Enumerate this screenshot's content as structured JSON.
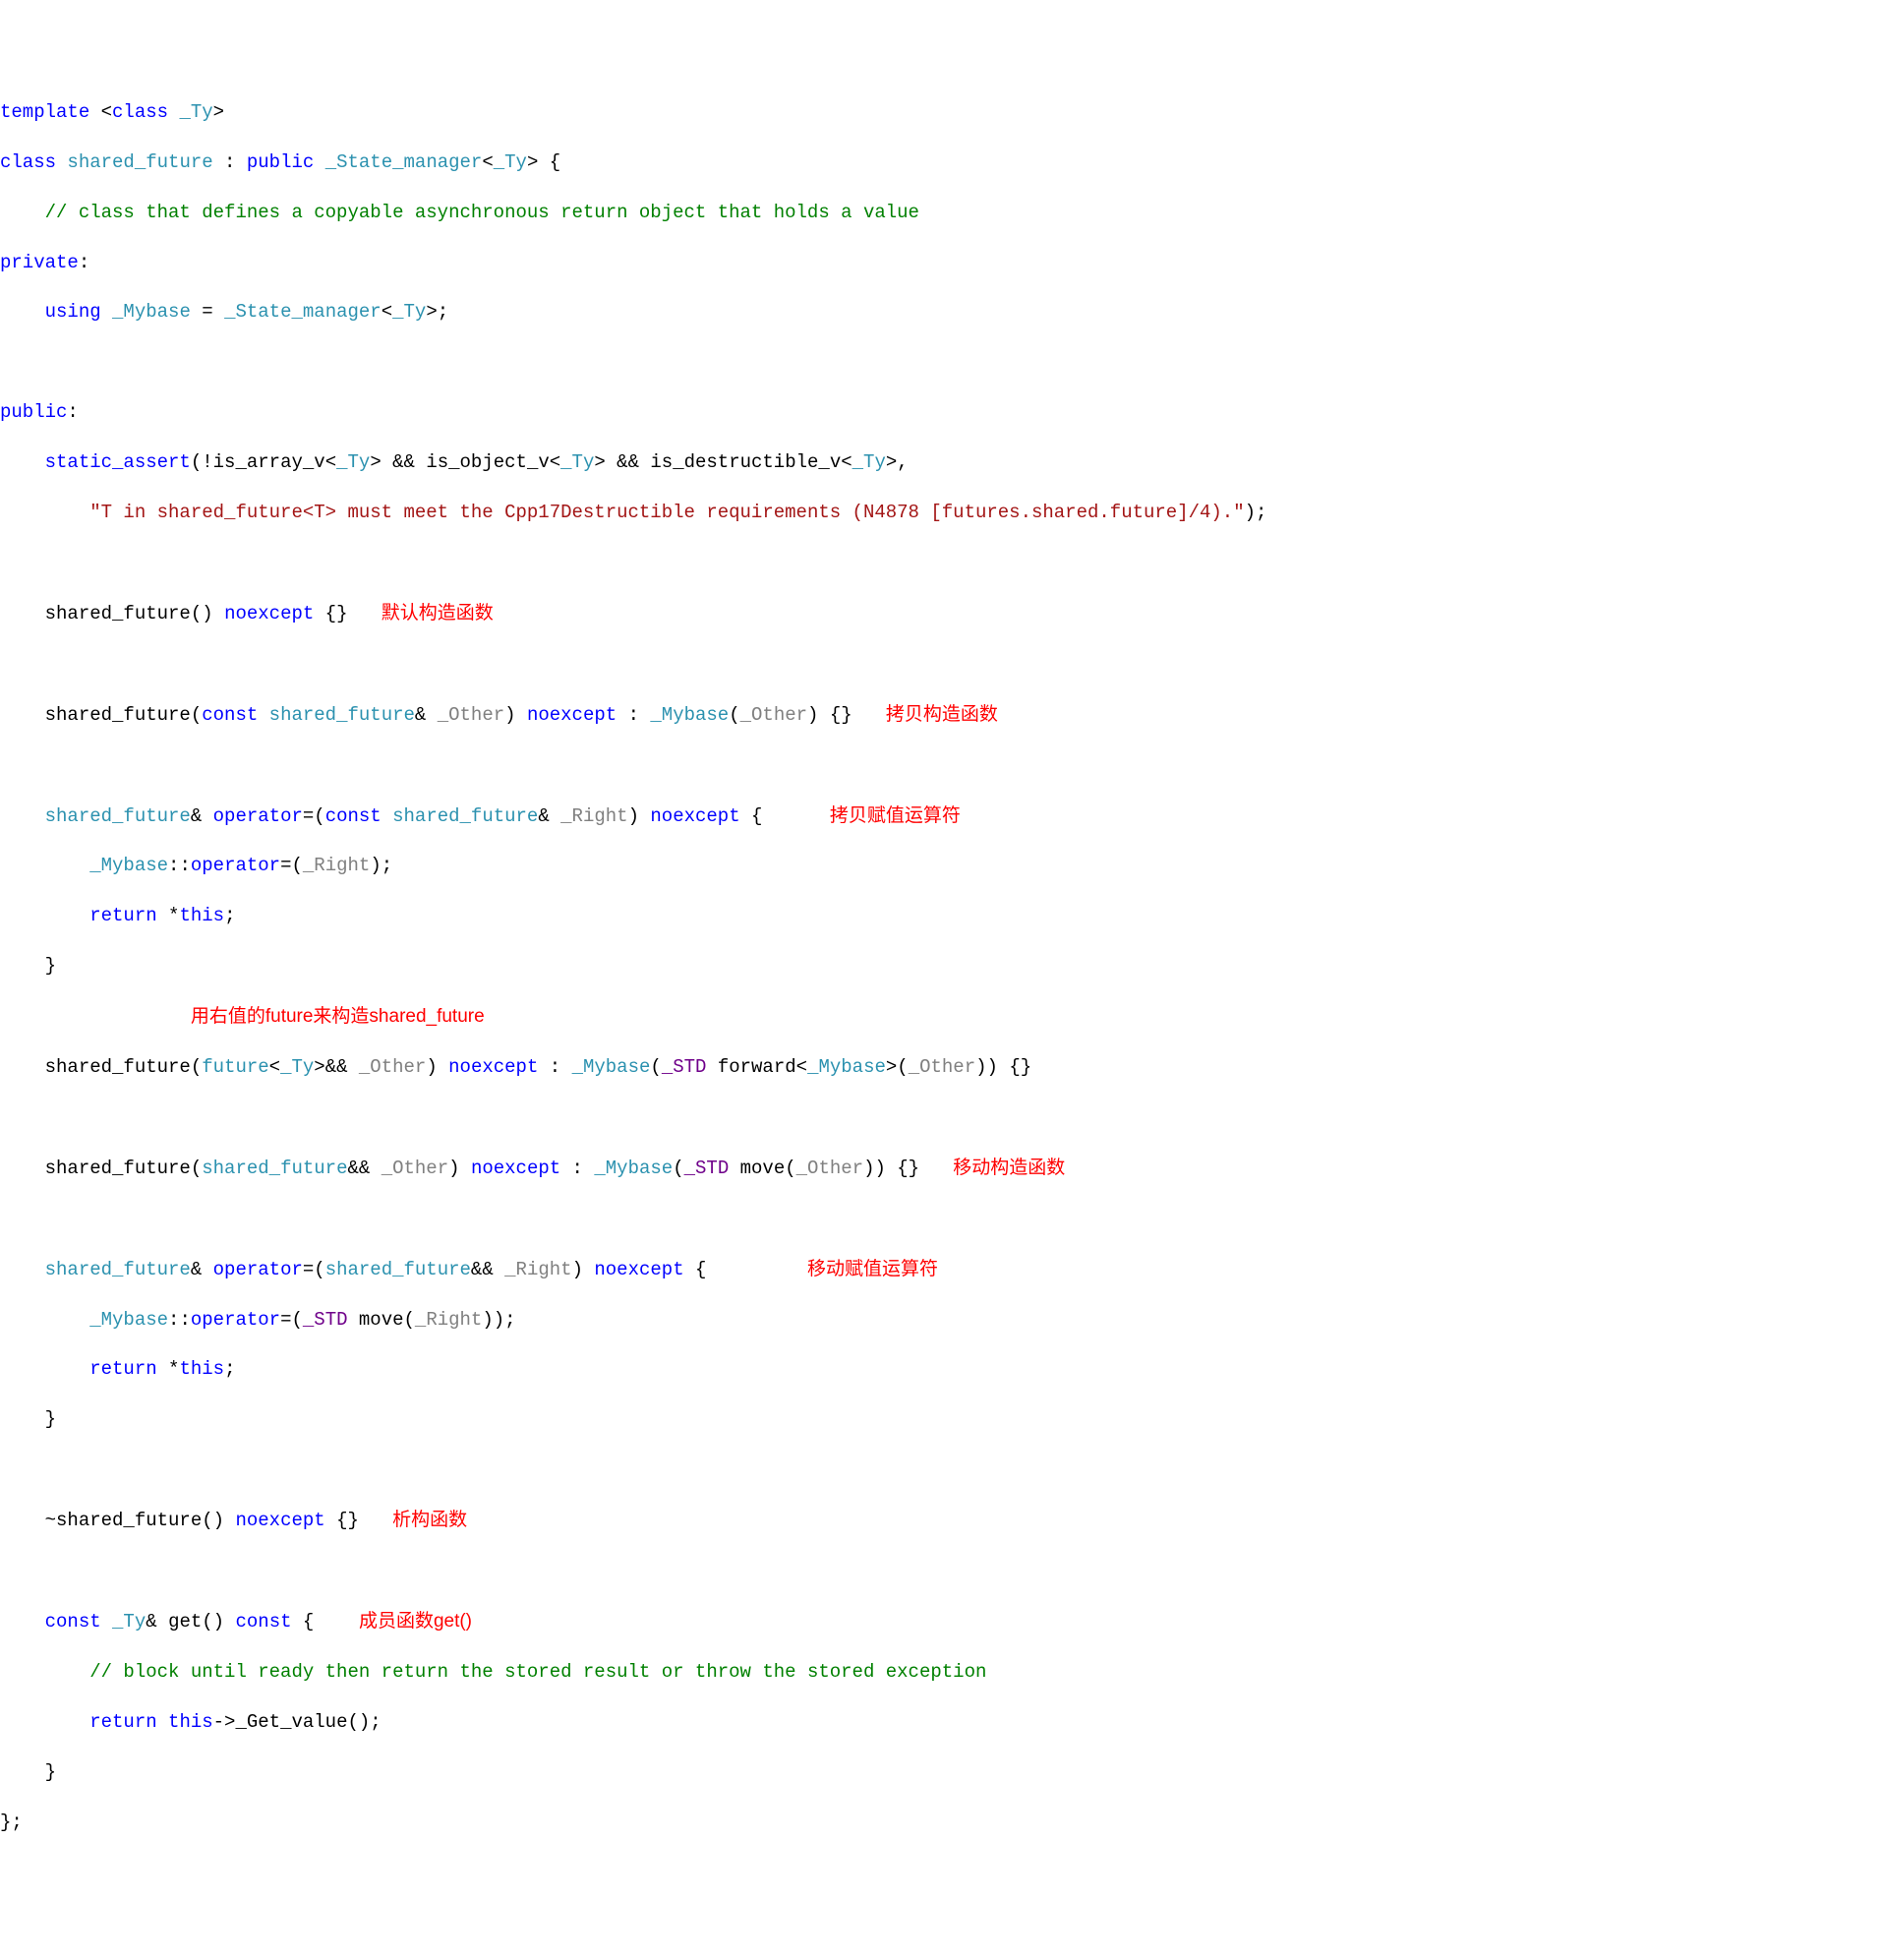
{
  "code": {
    "l01_template": "template",
    "l01_class": "class",
    "l01_ty": "_Ty",
    "l02_class": "class",
    "l02_shared_future": "shared_future",
    "l02_public": "public",
    "l02_state_manager": "_State_manager",
    "l02_ty": "_Ty",
    "l03_comment": "// class that defines a copyable asynchronous return object that holds a value",
    "l04_private": "private",
    "l05_using": "using",
    "l05_mybase": "_Mybase",
    "l05_state_manager": "_State_manager",
    "l05_ty": "_Ty",
    "l07_public": "public",
    "l08_static_assert": "static_assert",
    "l08_is_array_v": "is_array_v",
    "l08_ty1": "_Ty",
    "l08_is_object_v": "is_object_v",
    "l08_ty2": "_Ty",
    "l08_is_destructible_v": "is_destructible_v",
    "l08_ty3": "_Ty",
    "l09_string": "\"T in shared_future<T> must meet the Cpp17Destructible requirements (N4878 [futures.shared.future]/4).\"",
    "l11_sf": "shared_future",
    "l11_noexcept": "noexcept",
    "l13_sf": "shared_future",
    "l13_const": "const",
    "l13_sf2": "shared_future",
    "l13_other": "_Other",
    "l13_noexcept": "noexcept",
    "l13_mybase": "_Mybase",
    "l13_other2": "_Other",
    "l15_sf": "shared_future",
    "l15_operator": "operator",
    "l15_const": "const",
    "l15_sf2": "shared_future",
    "l15_right": "_Right",
    "l15_noexcept": "noexcept",
    "l16_mybase": "_Mybase",
    "l16_operator": "operator",
    "l16_right": "_Right",
    "l17_return": "return",
    "l17_this": "this",
    "l20_sf": "shared_future",
    "l20_future": "future",
    "l20_ty": "_Ty",
    "l20_other": "_Other",
    "l20_noexcept": "noexcept",
    "l20_mybase": "_Mybase",
    "l20_std": "_STD",
    "l20_forward": "forward",
    "l20_mybase2": "_Mybase",
    "l20_other2": "_Other",
    "l22_sf": "shared_future",
    "l22_sf2": "shared_future",
    "l22_other": "_Other",
    "l22_noexcept": "noexcept",
    "l22_mybase": "_Mybase",
    "l22_std": "_STD",
    "l22_move": "move",
    "l22_other2": "_Other",
    "l24_sf": "shared_future",
    "l24_operator": "operator",
    "l24_sf2": "shared_future",
    "l24_right": "_Right",
    "l24_noexcept": "noexcept",
    "l25_mybase": "_Mybase",
    "l25_operator": "operator",
    "l25_std": "_STD",
    "l25_move": "move",
    "l25_right": "_Right",
    "l26_return": "return",
    "l26_this": "this",
    "l29_sf": "shared_future",
    "l29_noexcept": "noexcept",
    "l31_const": "const",
    "l31_ty": "_Ty",
    "l31_get": "get",
    "l31_const2": "const",
    "l32_comment": "// block until ready then return the stored result or throw the stored exception",
    "l33_return": "return",
    "l33_this": "this",
    "l33_getvalue": "_Get_value"
  },
  "annotations": {
    "default_ctor": "默认构造函数",
    "copy_ctor": "拷贝构造函数",
    "copy_assign": "拷贝赋值运算符",
    "rvalue_future": "用右值的future来构造shared_future",
    "move_ctor": "移动构造函数",
    "move_assign": "移动赋值运算符",
    "dtor": "析构函数",
    "member_get": "成员函数get()"
  }
}
